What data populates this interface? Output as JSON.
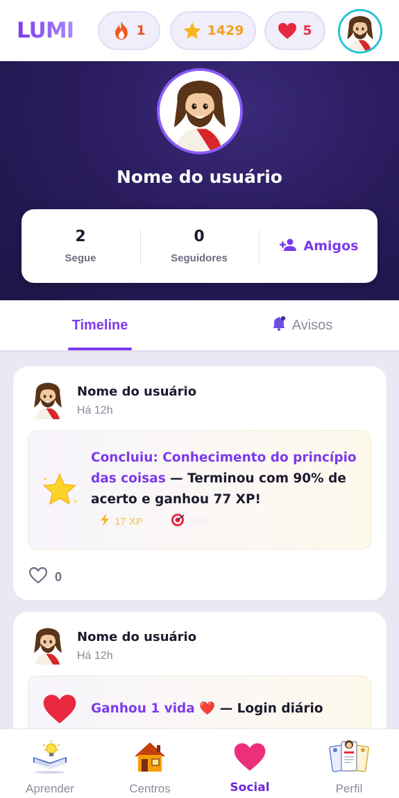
{
  "app": {
    "logo": "LUMI"
  },
  "topbar": {
    "streak": {
      "icon": "fire-icon",
      "value": "1"
    },
    "xp": {
      "icon": "star-icon",
      "value": "1429"
    },
    "lives": {
      "icon": "heart-icon",
      "value": "5"
    },
    "avatar": "jesus-avatar"
  },
  "profile": {
    "name": "Nome do usuário",
    "following": {
      "value": "2",
      "label": "Segue"
    },
    "followers": {
      "value": "0",
      "label": "Seguidores"
    },
    "friends_button": "Amigos"
  },
  "tabs": {
    "timeline": "Timeline",
    "notices": "Avisos",
    "active": "Timeline"
  },
  "feed": {
    "posts": [
      {
        "user": "Nome do usuário",
        "time": "Há 12h",
        "icon": "star-icon",
        "highlight": "Concluiu: Conhecimento do princípio das coisas",
        "text": " — Terminou com 90% de acerto e ganhou 77 XP!",
        "meta": [
          {
            "icon": "lightning-icon",
            "value": "17 XP"
          },
          {
            "icon": "target-icon",
            "value": "90%"
          }
        ],
        "likes": "0"
      },
      {
        "user": "Nome do usuário",
        "time": "Há 12h",
        "icon": "heart-icon",
        "highlight": "Ganhou 1 vida ❤️",
        "text": " — Login diário"
      }
    ]
  },
  "bottom_nav": {
    "items": [
      {
        "label": "Aprender",
        "icon": "book-lamp-icon"
      },
      {
        "label": "Centros",
        "icon": "house-icon"
      },
      {
        "label": "Social",
        "icon": "heart-icon"
      },
      {
        "label": "Perfil",
        "icon": "profile-cards-icon"
      }
    ],
    "active": "Social"
  },
  "colors": {
    "accent": "#7c3aed",
    "hero_bg": "#241a55",
    "avatar_ring": "#22c3d6"
  }
}
